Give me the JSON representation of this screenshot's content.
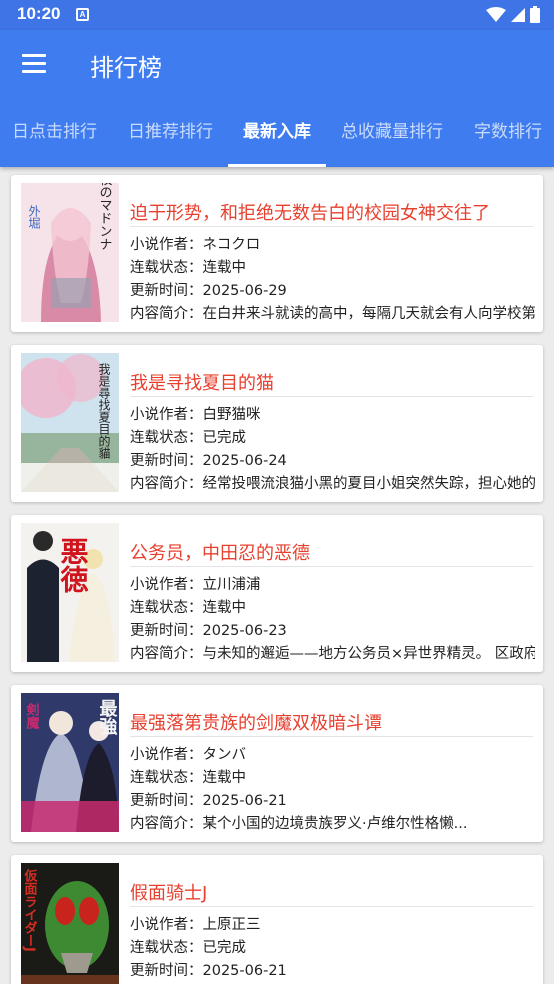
{
  "status_bar": {
    "time": "10:20",
    "notification": "A"
  },
  "app_bar": {
    "title": "排行榜"
  },
  "tabs": [
    {
      "label": "日点击排行"
    },
    {
      "label": "日推荐排行"
    },
    {
      "label": "最新入库"
    },
    {
      "label": "总收藏量排行"
    },
    {
      "label": "字数排行"
    }
  ],
  "active_tab": "最新入库",
  "labels": {
    "author": "小说作者：",
    "status": "连载状态：",
    "updated": "更新时间：",
    "summary": "内容简介："
  },
  "books": [
    {
      "title": "迫于形势，和拒绝无数告白的校园女神交往了",
      "author": "ネコクロ",
      "status": "连载中",
      "updated": "2025-06-29",
      "summary": "在白井来斗就读的高中，每隔几天就会有人向学校第一美少女告白",
      "cover_text": "学校のマドンナ",
      "colors": [
        "#f6e3ea",
        "#d98aa6",
        "#8a5a78"
      ]
    },
    {
      "title": "我是寻找夏目的猫",
      "author": "白野猫咪",
      "status": "已完成",
      "updated": "2025-06-24",
      "summary": "经常投喂流浪猫小黑的夏目小姐突然失踪，担心她的小黑开始了寻找",
      "cover_text": "我是尋找夏目的貓",
      "colors": [
        "#cfe3ef",
        "#f0b6cc",
        "#7fa07a"
      ]
    },
    {
      "title": "公务员，中田忍的恶德",
      "author": "立川浦浦",
      "status": "连载中",
      "updated": "2025-06-23",
      "summary": "与未知的邂逅——地方公务员×异世界精灵。 区政府",
      "cover_text": "悪徳",
      "colors": [
        "#f4f2ee",
        "#1d2230",
        "#d0141e"
      ]
    },
    {
      "title": "最强落第贵族的剑魔双极暗斗谭",
      "author": "タンバ",
      "status": "连载中",
      "updated": "2025-06-21",
      "summary": "某个小国的边境贵族罗义·卢维尔性格懒...",
      "cover_text": "最強",
      "colors": [
        "#2f3a6b",
        "#c82a6e",
        "#e6c24a"
      ]
    },
    {
      "title": "假面骑士J",
      "author": "上原正三",
      "status": "已完成",
      "updated": "2025-06-21",
      "summary": "",
      "cover_text": "仮面ライダーJ",
      "colors": [
        "#1a1a16",
        "#3e8a32",
        "#c9241c"
      ]
    }
  ]
}
